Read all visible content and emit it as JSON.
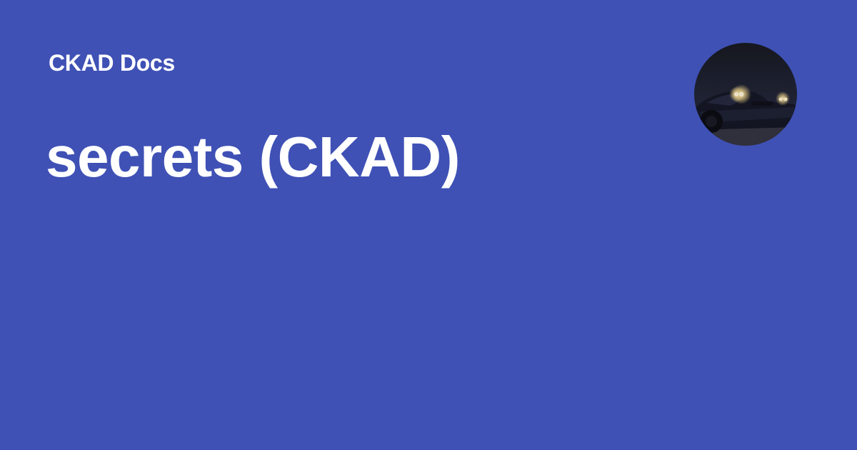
{
  "site": {
    "name": "CKAD Docs"
  },
  "page": {
    "title": "secrets (CKAD)"
  },
  "theme": {
    "background": "#3f51b5",
    "text": "#ffffff"
  },
  "logo": {
    "icon": "night-car-photo-icon"
  }
}
